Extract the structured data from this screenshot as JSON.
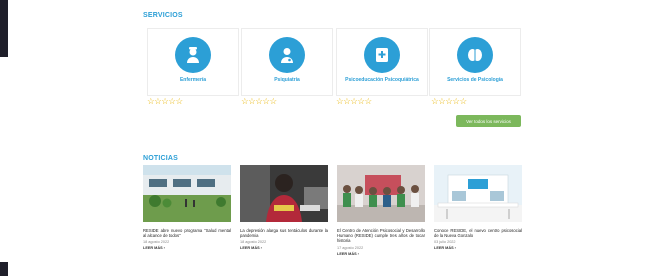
{
  "services": {
    "title": "SERVICIOS",
    "items": [
      {
        "label": "Enfermería",
        "icon": "nurse-icon",
        "rating": "☆☆☆☆☆"
      },
      {
        "label": "Psiquiatría",
        "icon": "doctor-icon",
        "rating": "☆☆☆☆☆"
      },
      {
        "label": "Psicoeducación Psicoquiátrica",
        "icon": "medical-book-icon",
        "rating": "☆☆☆☆☆"
      },
      {
        "label": "Servicios de Psicología",
        "icon": "brain-icon",
        "rating": "☆☆☆☆☆"
      }
    ],
    "cta_label": "Ver todos los servicios"
  },
  "news": {
    "title": "NOTICIAS",
    "items": [
      {
        "title": "RESIDE abre nuevo programa \"Salud mental al alcance de todos\"",
        "date": "18 agosto 2022",
        "more": "LEER MÁS ›"
      },
      {
        "title": "La depresión alarga sus tentáculos durante la pandemia",
        "date": "18 agosto 2022",
        "more": "LEER MÁS ›"
      },
      {
        "title": "El Centro de Atención Psicosocial y Desarrollo Humano (RESIDE) cumple tres años de tocar historia",
        "date": "17 agosto 2022",
        "more": "LEER MÁS ›"
      },
      {
        "title": "Conoce RESIDE, el nuevo centro psicosocial de la Nueva Gonzalo",
        "date": "03 julio 2022",
        "more": "LEER MÁS ›"
      }
    ]
  },
  "colors": {
    "accent": "#2c9fd6",
    "button": "#7cb85c",
    "stars": "#e8b400"
  }
}
